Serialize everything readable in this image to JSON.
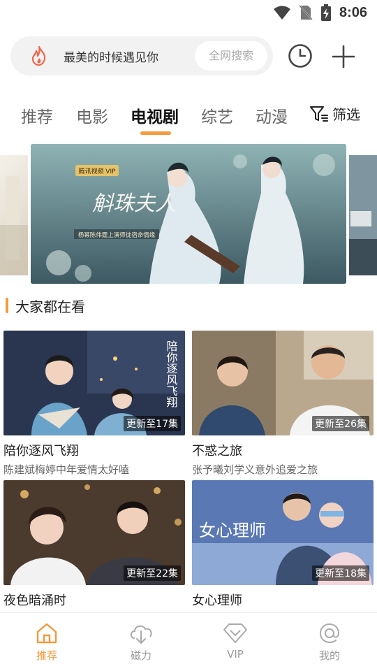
{
  "status_bar": {
    "time": "8:06"
  },
  "search": {
    "query_text": "最美的时候遇见你",
    "all_search_label": "全网搜索"
  },
  "tabs": [
    {
      "label": "推荐",
      "active": false
    },
    {
      "label": "电影",
      "active": false
    },
    {
      "label": "电视剧",
      "active": true
    },
    {
      "label": "综艺",
      "active": false
    },
    {
      "label": "动漫",
      "active": false
    }
  ],
  "filter_label": "筛选",
  "banner": {
    "brand": "腾讯视频 VIP",
    "poster_title": "斛珠夫人",
    "poster_tagline": "杨幂陈伟霆上演师徒宿命情缘"
  },
  "section_title": "大家都在看",
  "cards": [
    {
      "title": "陪你逐风飞翔",
      "subtitle": "陈建斌梅婷中年爱情太好嗑",
      "badge": "更新至17集",
      "poster_text": "陪你逐风飞翔"
    },
    {
      "title": "不惑之旅",
      "subtitle": "张予曦刘学义意外追爱之旅",
      "badge": "更新至26集"
    },
    {
      "title": "夜色暗涌时",
      "subtitle": "",
      "badge": "更新至22集"
    },
    {
      "title": "女心理师",
      "subtitle": "",
      "badge": "更新至18集",
      "poster_text": "女心理师"
    }
  ],
  "bottom_nav": [
    {
      "label": "推荐",
      "icon": "home-icon",
      "active": true
    },
    {
      "label": "磁力",
      "icon": "cloud-download-icon",
      "active": false
    },
    {
      "label": "VIP",
      "icon": "diamond-icon",
      "active": false
    },
    {
      "label": "我的",
      "icon": "at-icon",
      "active": false
    }
  ],
  "colors": {
    "accent": "#f39a3c"
  }
}
